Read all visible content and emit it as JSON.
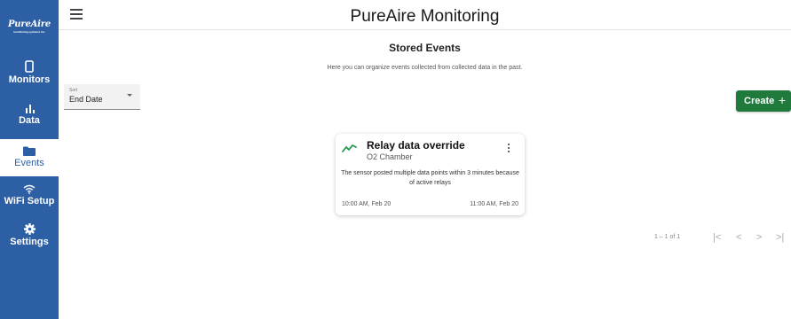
{
  "sidebar": {
    "logo_text": "PureAire",
    "logo_tagline": "monitoring systems inc.",
    "items": [
      {
        "label": "Monitors",
        "icon": "phone-icon",
        "active": false
      },
      {
        "label": "Data",
        "icon": "bar-chart-icon",
        "active": false
      },
      {
        "label": "Events",
        "icon": "folder-icon",
        "active": true
      },
      {
        "label": "WiFi Setup",
        "icon": "wifi-icon",
        "active": false
      },
      {
        "label": "Settings",
        "icon": "gear-icon",
        "active": false
      }
    ]
  },
  "header": {
    "title": "PureAire Monitoring",
    "menu_icon": "hamburger-menu-icon"
  },
  "main": {
    "title": "Stored Events",
    "subtitle": "Here you can organize events collected from collected data in the past.",
    "sort": {
      "label": "Sort",
      "value": "End Date"
    },
    "create_button": {
      "label": "Create",
      "icon": "+"
    }
  },
  "events": [
    {
      "title": "Relay data override",
      "subtitle": "O2 Chamber",
      "description": "The sensor posted multiple data points within 3 minutes because of active relays",
      "start": "10:00 AM, Feb 20",
      "end": "11:00 AM, Feb 20",
      "icon": "trend-line-icon"
    }
  ],
  "pagination": {
    "range": "1 – 1 of 1",
    "first_icon": "|<",
    "prev_icon": "<",
    "next_icon": ">",
    "last_icon": ">|"
  },
  "colors": {
    "sidebar": "#2d5fa4",
    "create_button": "#1f7a3b",
    "trend_icon": "#1f9a4a"
  }
}
